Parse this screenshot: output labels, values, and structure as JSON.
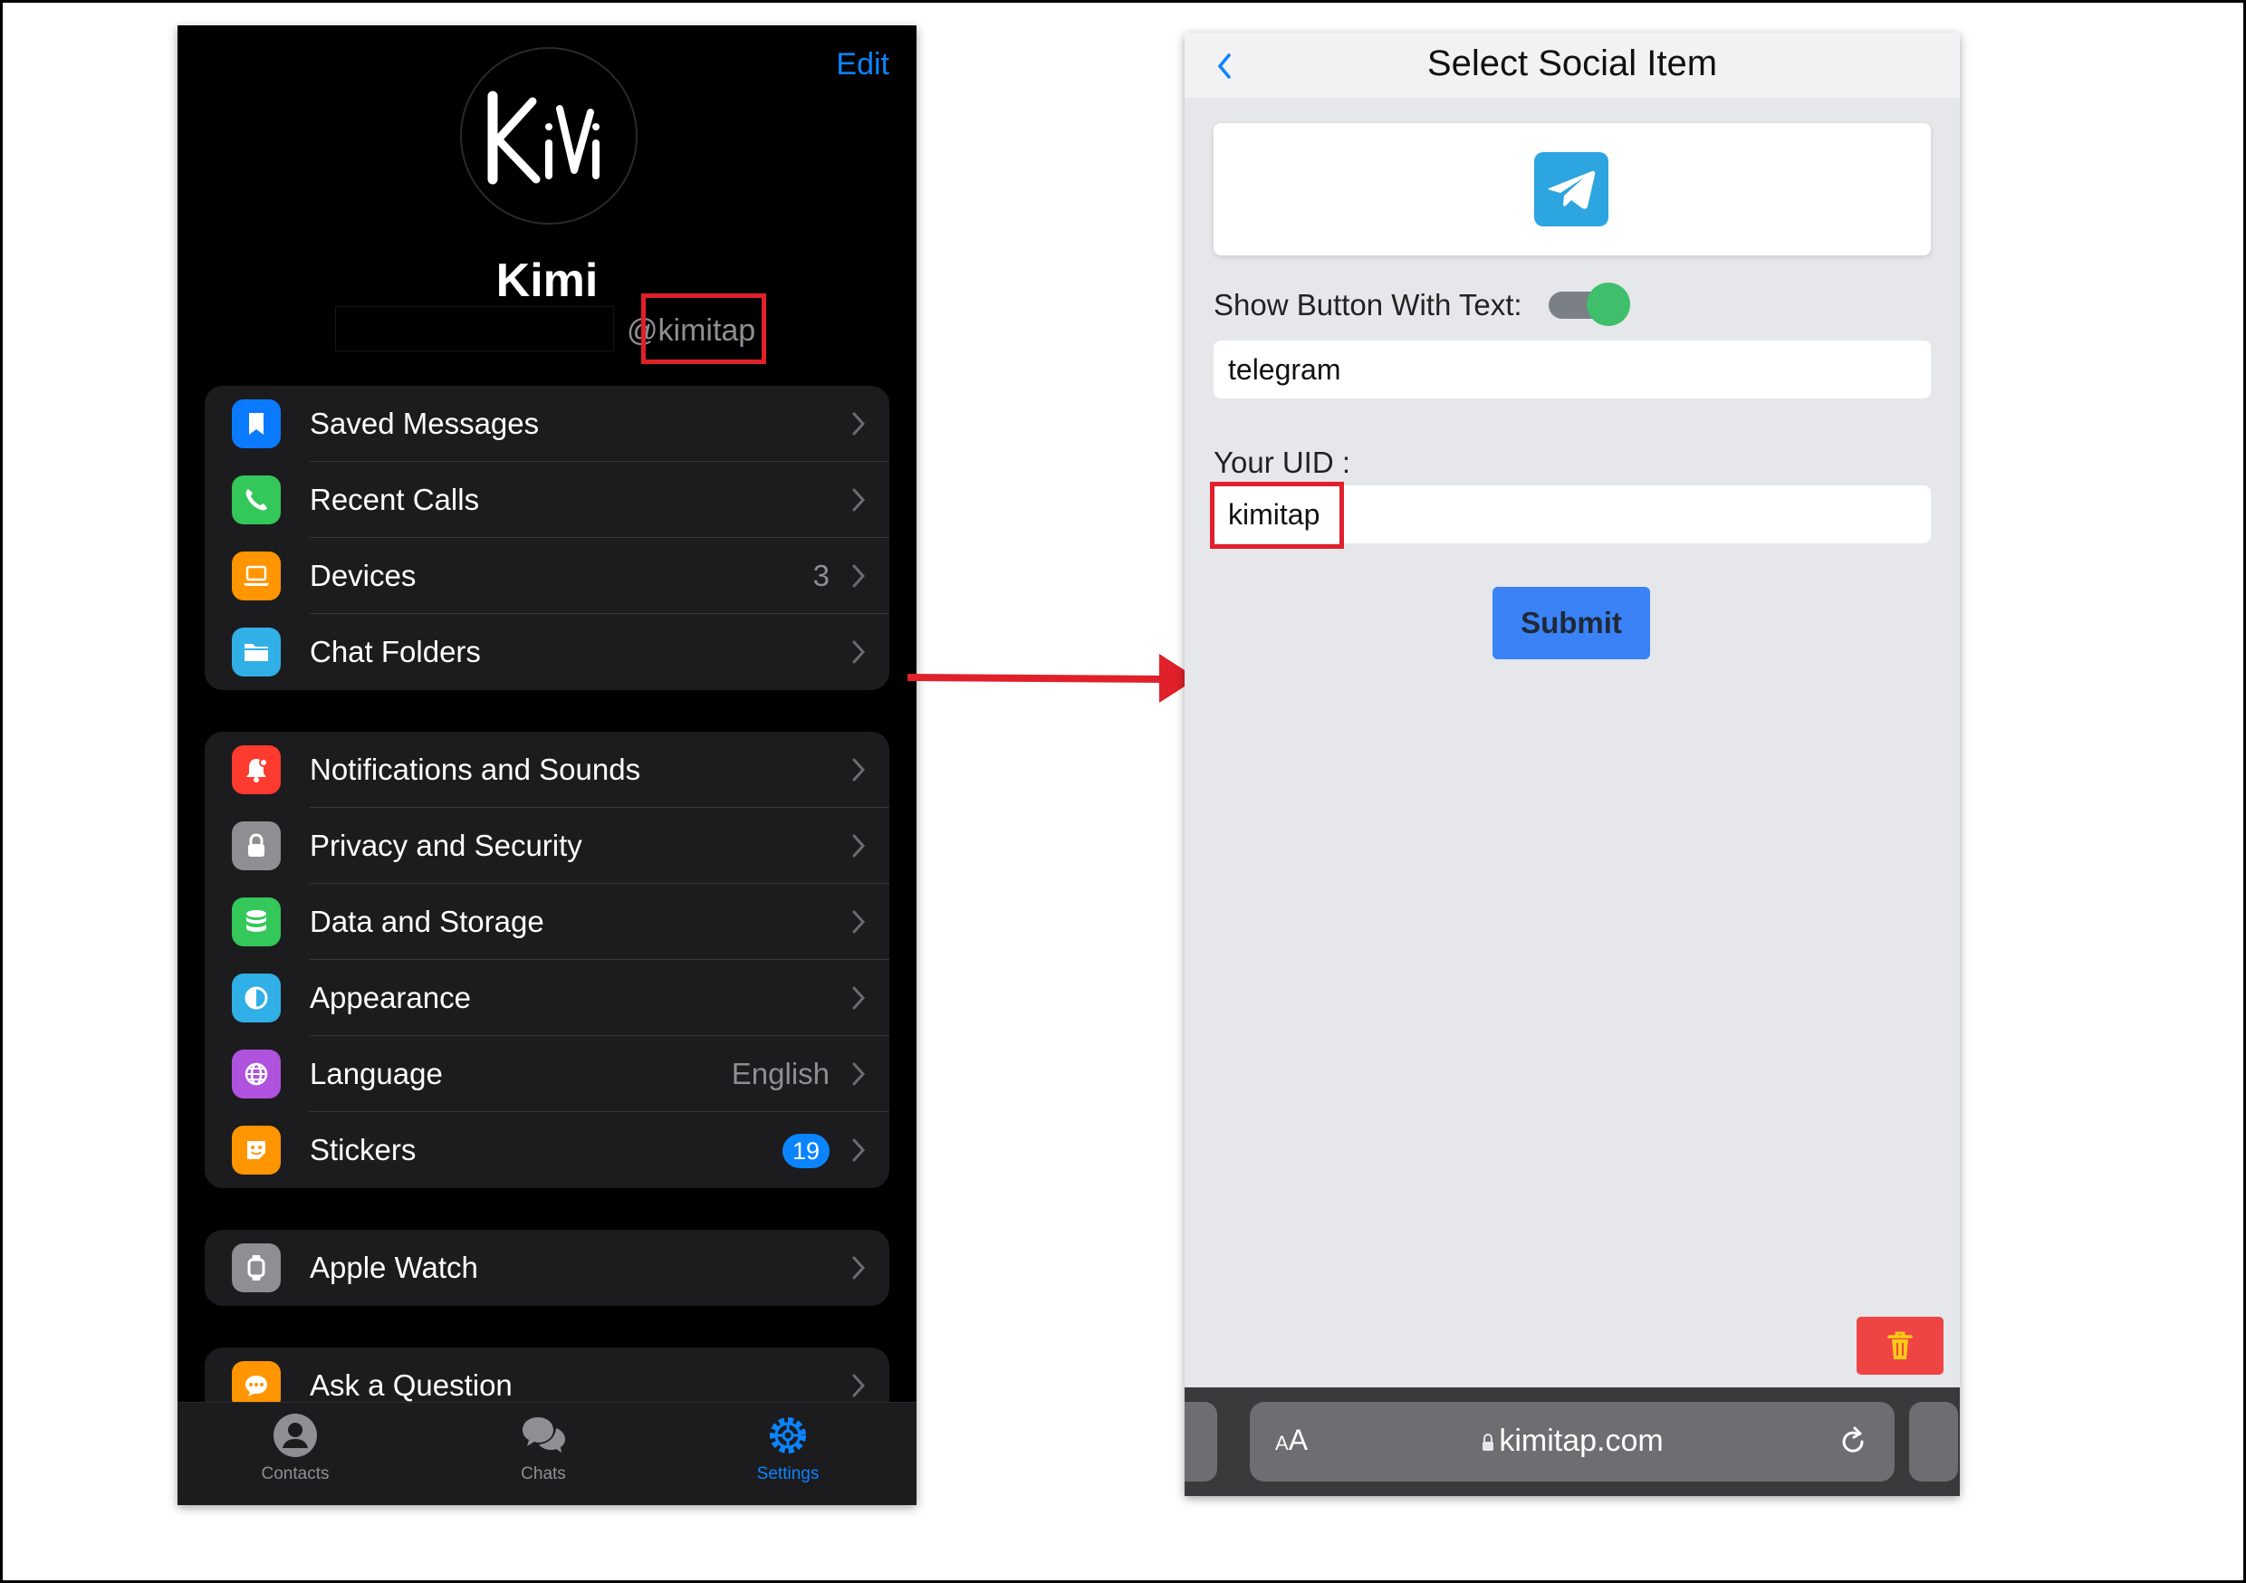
{
  "left_screen": {
    "edit_label": "Edit",
    "profile": {
      "name": "Kimi",
      "username": "@kimitap",
      "avatar_text": "KiMi"
    },
    "groups": [
      [
        {
          "label": "Saved Messages",
          "icon": "bookmark-icon",
          "color": "#0a7aff"
        },
        {
          "label": "Recent Calls",
          "icon": "phone-icon",
          "color": "#34c759"
        },
        {
          "label": "Devices",
          "icon": "laptop-icon",
          "color": "#ff9500",
          "value": "3"
        },
        {
          "label": "Chat Folders",
          "icon": "folder-icon",
          "color": "#30b0e6"
        }
      ],
      [
        {
          "label": "Notifications and Sounds",
          "icon": "bell-icon",
          "color": "#ff3b30"
        },
        {
          "label": "Privacy and Security",
          "icon": "lock-icon",
          "color": "#8e8e93"
        },
        {
          "label": "Data and Storage",
          "icon": "database-icon",
          "color": "#34c759"
        },
        {
          "label": "Appearance",
          "icon": "half-circle-icon",
          "color": "#30b0e6"
        },
        {
          "label": "Language",
          "icon": "globe-icon",
          "color": "#af52de",
          "value": "English"
        },
        {
          "label": "Stickers",
          "icon": "sticker-icon",
          "color": "#ff9500",
          "badge": "19"
        }
      ],
      [
        {
          "label": "Apple Watch",
          "icon": "watch-icon",
          "color": "#8e8e93"
        }
      ],
      [
        {
          "label": "Ask a Question",
          "icon": "chat-bubble-icon",
          "color": "#ff9500"
        }
      ]
    ],
    "tabs": [
      {
        "label": "Contacts",
        "icon": "person-icon",
        "active": false
      },
      {
        "label": "Chats",
        "icon": "chats-icon",
        "active": false
      },
      {
        "label": "Settings",
        "icon": "gear-icon",
        "active": true
      }
    ]
  },
  "right_screen": {
    "title": "Select Social Item",
    "social_icon": "telegram-icon",
    "toggle_label": "Show Button With Text:",
    "toggle_on": true,
    "button_text_value": "telegram",
    "uid_label": "Your UID :",
    "uid_value": "kimitap",
    "submit_label": "Submit",
    "browser": {
      "aa_small": "A",
      "aa_large": "A",
      "url": "kimitap.com"
    }
  },
  "colors": {
    "highlight": "#e0202a",
    "ios_blue": "#0a84ff",
    "submit_blue": "#3b82f6",
    "delete_red": "#ef4444",
    "toggle_green": "#3fbf6b",
    "telegram_blue": "#2ca5e0"
  }
}
